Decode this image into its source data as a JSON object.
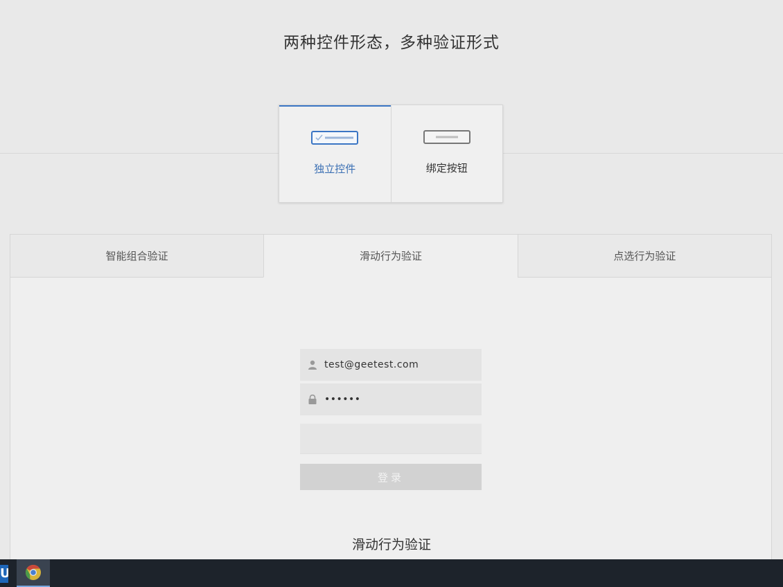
{
  "page_title": "两种控件形态，多种验证形式",
  "mode_switch": {
    "options": [
      {
        "label": "独立控件",
        "active": true
      },
      {
        "label": "绑定按钮",
        "active": false
      }
    ]
  },
  "demo": {
    "tabs": [
      {
        "label": "智能组合验证",
        "active": false
      },
      {
        "label": "滑动行为验证",
        "active": true
      },
      {
        "label": "点选行为验证",
        "active": false
      }
    ],
    "form": {
      "username_value": "test@geetest.com",
      "password_value": "••••••",
      "login_label": "登录"
    },
    "section_heading": "滑动行为验证"
  },
  "taskbar": {
    "app1_glyph": "U",
    "apps": [
      "chrome-icon"
    ]
  },
  "colors": {
    "accent": "#3a75c4",
    "background": "#e9e9e9"
  }
}
